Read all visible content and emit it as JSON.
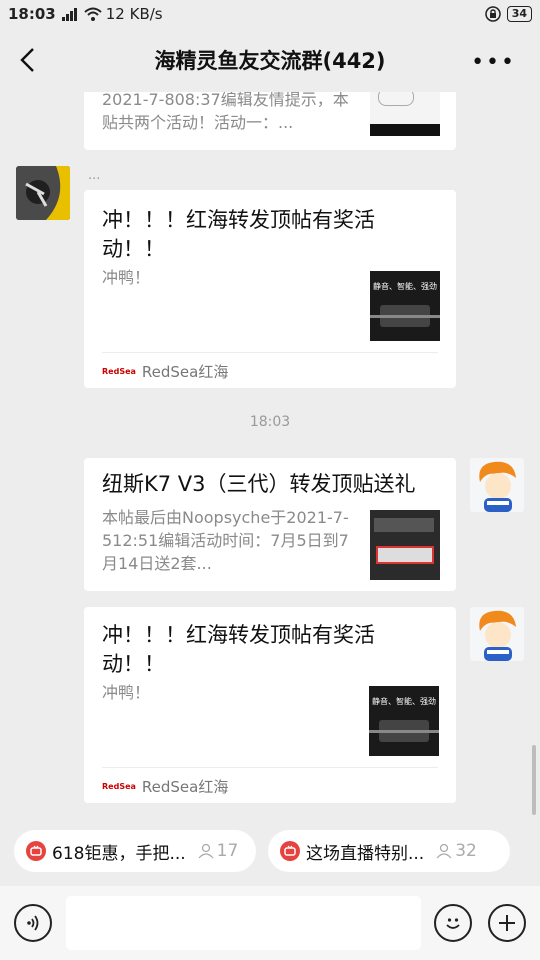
{
  "status_bar": {
    "time": "18:03",
    "net_type": "3G",
    "speed": "12 KB/s",
    "battery": "34"
  },
  "header": {
    "title": "海精灵鱼友交流群(442)",
    "more": "•••"
  },
  "messages": [
    {
      "title": "",
      "desc": "2021-7-808:37编辑友情提示，本贴共两个活动！活动一：..."
    },
    {
      "sender": "...",
      "title": "冲！！！红海转发顶帖有奖活动！！",
      "desc": "冲鸭！",
      "thumb_text": "静音、智能、强劲",
      "source": "RedSea红海",
      "source_logo": "RedSea"
    },
    {
      "title": "纽斯K7 V3（三代）转发顶贴送礼",
      "desc": "本帖最后由Noopsyche于2021-7-512:51编辑活动时间：7月5日到7月14日送2套..."
    },
    {
      "title": "冲！！！红海转发顶帖有奖活动！！",
      "desc": "冲鸭！",
      "thumb_text": "静音、智能、强劲",
      "source": "RedSea红海",
      "source_logo": "RedSea"
    }
  ],
  "timestamp": "18:03",
  "live": [
    {
      "label": "618钜惠，手把...",
      "count": "17"
    },
    {
      "label": "这场直播特别...",
      "count": "32"
    }
  ],
  "colors": {
    "background": "#ededed",
    "accent_red": "#e64340"
  }
}
